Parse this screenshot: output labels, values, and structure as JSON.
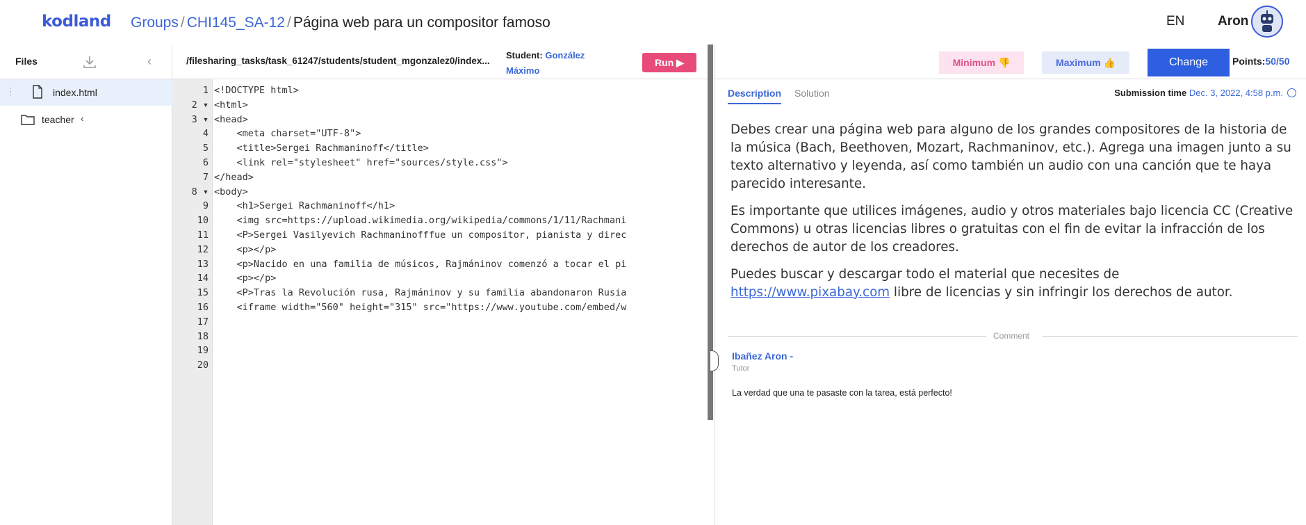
{
  "header": {
    "logo": "kodland",
    "breadcrumb": {
      "groups": "Groups",
      "separator": "/",
      "group": "CHI145_SA-12",
      "page": "Página web para un compositor famoso"
    },
    "lang": "EN",
    "user": "Aron"
  },
  "files": {
    "title": "Files",
    "items": [
      {
        "name": "index.html",
        "type": "file"
      },
      {
        "name": "teacher",
        "type": "folder"
      }
    ],
    "folder_chevron": "‹",
    "collapse_glyph": "‹",
    "drag_glyph": "⋮"
  },
  "editor": {
    "path": "/filesharing_tasks/task_61247/students/student_mgonzalez0/index...",
    "student_label": "Student:",
    "student_name": "González",
    "student_name2": "Máximo",
    "run_label": "Run ▶",
    "line_numbers": [
      "1",
      "2 ▾",
      "3 ▾",
      "4",
      "5",
      "6",
      "7",
      "8 ▾",
      "9",
      "10",
      "11",
      "12",
      "13",
      "14",
      "15",
      "16",
      "17",
      "18",
      "19",
      "20"
    ],
    "lines": [
      "<!DOCTYPE html>",
      "<html>",
      "<head>",
      "    <meta charset=\"UTF-8\">",
      "    <title>Sergei Rachmaninoff</title>",
      "    <link rel=\"stylesheet\" href=\"sources/style.css\">",
      "</head>",
      "<body>",
      "    <h1>Sergei Rachmaninoff</h1>",
      "    <img src=https://upload.wikimedia.org/wikipedia/commons/1/11/Rachmani",
      "    <P>Sergei Vasilyevich Rachmaninofffue un compositor, pianista y direc",
      "    <p></p>",
      "    <p>Nacido en una familia de músicos, Rajmáninov comenzó a tocar el pi",
      "    <p></p>",
      "    <P>Tras la Revolución rusa, Rajmáninov y su familia abandonaron Rusia",
      "    <iframe width=\"560\" height=\"315\" src=\"https://www.youtube.com/embed/w",
      "",
      "",
      "",
      ""
    ]
  },
  "review": {
    "minimum_label": "Minimum 👎",
    "maximum_label": "Maximum 👍",
    "change_label": "Change",
    "points_label": "Points:",
    "points_value": "50/50",
    "tabs": [
      "Description",
      "Solution"
    ],
    "submission_label": "Submission time",
    "submission_value": "Dec. 3, 2022, 4:58 p.m.",
    "description": {
      "p1": "Debes crear una página web para alguno de los grandes compositores de la historia de la música (Bach, Beethoven, Mozart, Rachmaninov, etc.). Agrega una imagen junto a su texto alternativo y leyenda, así como también un audio con una canción que te haya parecido interesante.",
      "p2": "Es importante que utilices imágenes, audio y otros materiales bajo licencia CC (Creative Commons) u otras licencias libres o gratuitas con el fin de evitar la infracción de los derechos de autor de los creadores.",
      "p3_before": "Puedes buscar y descargar todo el material que necesites de",
      "p3_link": "https://www.pixabay.com",
      "p3_after": " libre de licencias y sin infringir los derechos de autor."
    },
    "comment_label": "Comment",
    "comment": {
      "author": "Ibañez Aron -",
      "role": "Tutor",
      "text": "La verdad que una te pasaste con la tarea, está perfecto!"
    }
  },
  "colors": {
    "accent": "#3b67d6",
    "run": "#e84b7a",
    "change": "#2e5fe0",
    "min_bg": "#fce3ef",
    "max_bg": "#e6ebfa"
  }
}
